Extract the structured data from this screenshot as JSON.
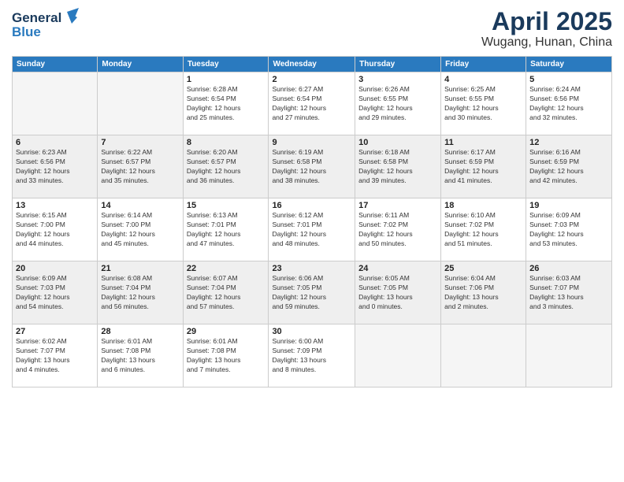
{
  "header": {
    "logo_general": "General",
    "logo_blue": "Blue",
    "month_title": "April 2025",
    "location": "Wugang, Hunan, China"
  },
  "weekdays": [
    "Sunday",
    "Monday",
    "Tuesday",
    "Wednesday",
    "Thursday",
    "Friday",
    "Saturday"
  ],
  "weeks": [
    [
      {
        "day": "",
        "info": ""
      },
      {
        "day": "",
        "info": ""
      },
      {
        "day": "1",
        "info": "Sunrise: 6:28 AM\nSunset: 6:54 PM\nDaylight: 12 hours\nand 25 minutes."
      },
      {
        "day": "2",
        "info": "Sunrise: 6:27 AM\nSunset: 6:54 PM\nDaylight: 12 hours\nand 27 minutes."
      },
      {
        "day": "3",
        "info": "Sunrise: 6:26 AM\nSunset: 6:55 PM\nDaylight: 12 hours\nand 29 minutes."
      },
      {
        "day": "4",
        "info": "Sunrise: 6:25 AM\nSunset: 6:55 PM\nDaylight: 12 hours\nand 30 minutes."
      },
      {
        "day": "5",
        "info": "Sunrise: 6:24 AM\nSunset: 6:56 PM\nDaylight: 12 hours\nand 32 minutes."
      }
    ],
    [
      {
        "day": "6",
        "info": "Sunrise: 6:23 AM\nSunset: 6:56 PM\nDaylight: 12 hours\nand 33 minutes."
      },
      {
        "day": "7",
        "info": "Sunrise: 6:22 AM\nSunset: 6:57 PM\nDaylight: 12 hours\nand 35 minutes."
      },
      {
        "day": "8",
        "info": "Sunrise: 6:20 AM\nSunset: 6:57 PM\nDaylight: 12 hours\nand 36 minutes."
      },
      {
        "day": "9",
        "info": "Sunrise: 6:19 AM\nSunset: 6:58 PM\nDaylight: 12 hours\nand 38 minutes."
      },
      {
        "day": "10",
        "info": "Sunrise: 6:18 AM\nSunset: 6:58 PM\nDaylight: 12 hours\nand 39 minutes."
      },
      {
        "day": "11",
        "info": "Sunrise: 6:17 AM\nSunset: 6:59 PM\nDaylight: 12 hours\nand 41 minutes."
      },
      {
        "day": "12",
        "info": "Sunrise: 6:16 AM\nSunset: 6:59 PM\nDaylight: 12 hours\nand 42 minutes."
      }
    ],
    [
      {
        "day": "13",
        "info": "Sunrise: 6:15 AM\nSunset: 7:00 PM\nDaylight: 12 hours\nand 44 minutes."
      },
      {
        "day": "14",
        "info": "Sunrise: 6:14 AM\nSunset: 7:00 PM\nDaylight: 12 hours\nand 45 minutes."
      },
      {
        "day": "15",
        "info": "Sunrise: 6:13 AM\nSunset: 7:01 PM\nDaylight: 12 hours\nand 47 minutes."
      },
      {
        "day": "16",
        "info": "Sunrise: 6:12 AM\nSunset: 7:01 PM\nDaylight: 12 hours\nand 48 minutes."
      },
      {
        "day": "17",
        "info": "Sunrise: 6:11 AM\nSunset: 7:02 PM\nDaylight: 12 hours\nand 50 minutes."
      },
      {
        "day": "18",
        "info": "Sunrise: 6:10 AM\nSunset: 7:02 PM\nDaylight: 12 hours\nand 51 minutes."
      },
      {
        "day": "19",
        "info": "Sunrise: 6:09 AM\nSunset: 7:03 PM\nDaylight: 12 hours\nand 53 minutes."
      }
    ],
    [
      {
        "day": "20",
        "info": "Sunrise: 6:09 AM\nSunset: 7:03 PM\nDaylight: 12 hours\nand 54 minutes."
      },
      {
        "day": "21",
        "info": "Sunrise: 6:08 AM\nSunset: 7:04 PM\nDaylight: 12 hours\nand 56 minutes."
      },
      {
        "day": "22",
        "info": "Sunrise: 6:07 AM\nSunset: 7:04 PM\nDaylight: 12 hours\nand 57 minutes."
      },
      {
        "day": "23",
        "info": "Sunrise: 6:06 AM\nSunset: 7:05 PM\nDaylight: 12 hours\nand 59 minutes."
      },
      {
        "day": "24",
        "info": "Sunrise: 6:05 AM\nSunset: 7:05 PM\nDaylight: 13 hours\nand 0 minutes."
      },
      {
        "day": "25",
        "info": "Sunrise: 6:04 AM\nSunset: 7:06 PM\nDaylight: 13 hours\nand 2 minutes."
      },
      {
        "day": "26",
        "info": "Sunrise: 6:03 AM\nSunset: 7:07 PM\nDaylight: 13 hours\nand 3 minutes."
      }
    ],
    [
      {
        "day": "27",
        "info": "Sunrise: 6:02 AM\nSunset: 7:07 PM\nDaylight: 13 hours\nand 4 minutes."
      },
      {
        "day": "28",
        "info": "Sunrise: 6:01 AM\nSunset: 7:08 PM\nDaylight: 13 hours\nand 6 minutes."
      },
      {
        "day": "29",
        "info": "Sunrise: 6:01 AM\nSunset: 7:08 PM\nDaylight: 13 hours\nand 7 minutes."
      },
      {
        "day": "30",
        "info": "Sunrise: 6:00 AM\nSunset: 7:09 PM\nDaylight: 13 hours\nand 8 minutes."
      },
      {
        "day": "",
        "info": ""
      },
      {
        "day": "",
        "info": ""
      },
      {
        "day": "",
        "info": ""
      }
    ]
  ]
}
